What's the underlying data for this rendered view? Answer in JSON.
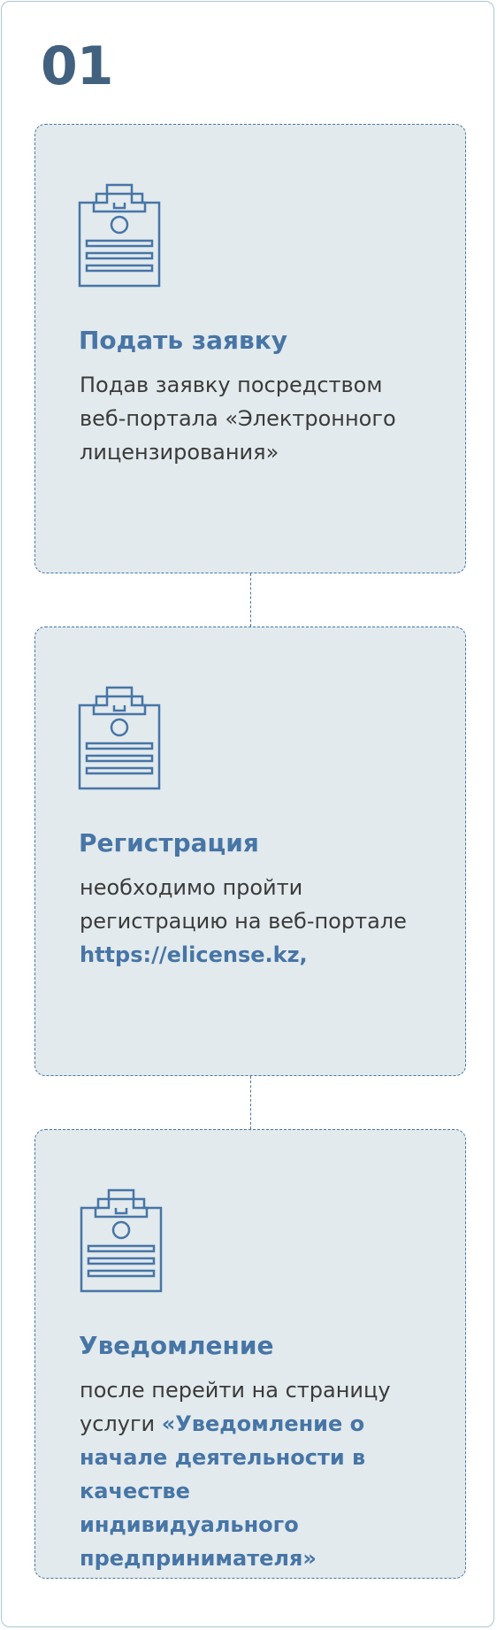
{
  "step_number": "01",
  "cards": [
    {
      "icon": "clipboard-icon",
      "title": "Подать заявку",
      "text": "Подав заявку посредством веб-портала «Электронного лицензирования»"
    },
    {
      "icon": "clipboard-icon",
      "title": "Регистрация",
      "text": "необходимо пройти регистрацию на веб-портале ",
      "link": "https://elicense.kz,"
    },
    {
      "icon": "clipboard-icon",
      "title": "Уведомление",
      "text": "после перейти на страницу услуги ",
      "link": "«Уведомление о начале деятельности в качестве индивидуального предпринимателя»"
    }
  ],
  "colors": {
    "accent": "#4775a6",
    "number": "#41617f",
    "card_bg": "#e2eaed",
    "frame_border": "#a9c8cc",
    "text": "#3b3b3b"
  }
}
